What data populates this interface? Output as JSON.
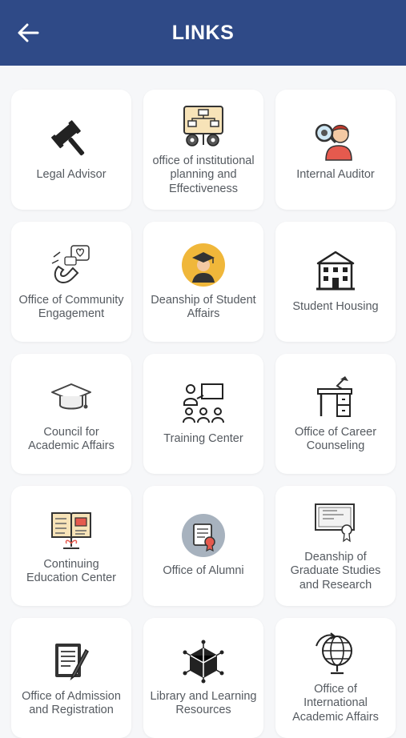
{
  "header": {
    "title": "LINKS"
  },
  "links": [
    {
      "label": "Legal Advisor",
      "icon": "gavel-icon"
    },
    {
      "label": "office of institutional planning and Effectiveness",
      "icon": "flowchart-gears-icon"
    },
    {
      "label": "Internal Auditor",
      "icon": "auditor-magnifier-icon"
    },
    {
      "label": "Office of Community Engagement",
      "icon": "magnet-heart-icon"
    },
    {
      "label": "Deanship of Student Affairs",
      "icon": "graduate-avatar-icon"
    },
    {
      "label": "Student Housing",
      "icon": "building-icon"
    },
    {
      "label": "Council for Academic Affairs",
      "icon": "graduation-cap-icon"
    },
    {
      "label": "Training Center",
      "icon": "trainees-board-icon"
    },
    {
      "label": "Office of Career Counseling",
      "icon": "desk-lamp-icon"
    },
    {
      "label": "Continuing Education Center",
      "icon": "open-book-icon"
    },
    {
      "label": "Office of Alumni",
      "icon": "certificate-badge-icon"
    },
    {
      "label": "Deanship of Graduate Studies and Research",
      "icon": "diploma-icon"
    },
    {
      "label": "Office of Admission and Registration",
      "icon": "form-pen-icon"
    },
    {
      "label": "Library and Learning Resources",
      "icon": "network-cube-icon"
    },
    {
      "label": "Office of International Academic Affairs",
      "icon": "globe-icon"
    }
  ],
  "colors": {
    "appbar": "#2f4a87",
    "background": "#f6f7f9",
    "card": "#ffffff",
    "label": "#555a60",
    "accent": "#f0b73a"
  }
}
